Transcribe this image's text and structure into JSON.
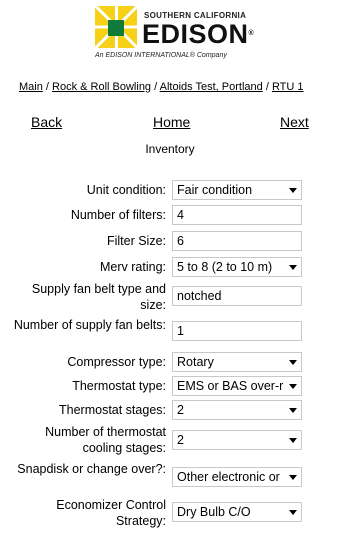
{
  "brand": {
    "line1": "SOUTHERN CALIFORNIA",
    "name": "EDISON",
    "reg": "®",
    "tagline": "An EDISON INTERNATIONAL® Company"
  },
  "breadcrumb": {
    "items": [
      "Main",
      "Rock & Roll Bowling",
      "Altoids Test, Portland",
      "RTU 1"
    ],
    "separator": " / "
  },
  "nav": {
    "back": "Back",
    "home": "Home",
    "next": "Next"
  },
  "section_title": "Inventory",
  "form": {
    "unit_condition": {
      "label": "Unit condition:",
      "value": "Fair condition"
    },
    "num_filters": {
      "label": "Number of filters:",
      "value": "4"
    },
    "filter_size": {
      "label": "Filter Size:",
      "value": "6"
    },
    "merv": {
      "label": "Merv rating:",
      "value": "5 to 8 (2 to 10 m)"
    },
    "fan_belt_type": {
      "label": "Supply fan belt type and size:",
      "value": "notched"
    },
    "fan_belts": {
      "label": "Number of supply fan belts:",
      "value": "1"
    },
    "compressor": {
      "label": "Compressor type:",
      "value": "Rotary"
    },
    "thermostat_type": {
      "label": "Thermostat type:",
      "value": "EMS or BAS over-r"
    },
    "thermostat_stages": {
      "label": "Thermostat stages:",
      "value": "2"
    },
    "cooling_stages": {
      "label": "Number of thermostat cooling stages:",
      "value": "2"
    },
    "snapdisk": {
      "label": "Snapdisk or change over?:",
      "value": "Other electronic or"
    },
    "economizer": {
      "label": "Economizer Control Strategy:",
      "value": "Dry Bulb C/O"
    }
  }
}
